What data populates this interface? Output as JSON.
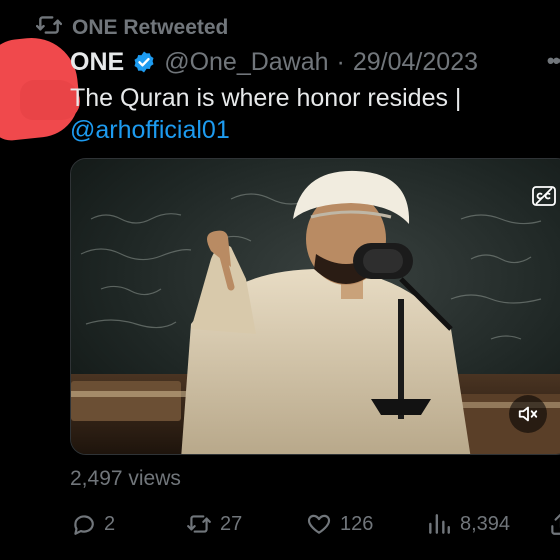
{
  "retweet_banner": {
    "label": "ONE Retweeted",
    "icon": "retweet-icon"
  },
  "author": {
    "name": "ONE",
    "verified": true,
    "handle": "@One_Dawah",
    "separator": "·",
    "date": "29/04/2023"
  },
  "tweet": {
    "text": "The Quran is where honor resides |",
    "mention": "@arhofficial01"
  },
  "media": {
    "type": "video",
    "captions_icon": "closed-captions-icon",
    "mute_icon": "speaker-muted-icon"
  },
  "stats": {
    "views_label": "2,497 views"
  },
  "actions": {
    "reply_count": "2",
    "retweet_count": "27",
    "like_count": "126",
    "views_count": "8,394"
  },
  "colors": {
    "background": "#000000",
    "text": "#e7e9ea",
    "muted": "#71767b",
    "link": "#1d9bf0",
    "verified_badge": "#1d9bf0"
  }
}
